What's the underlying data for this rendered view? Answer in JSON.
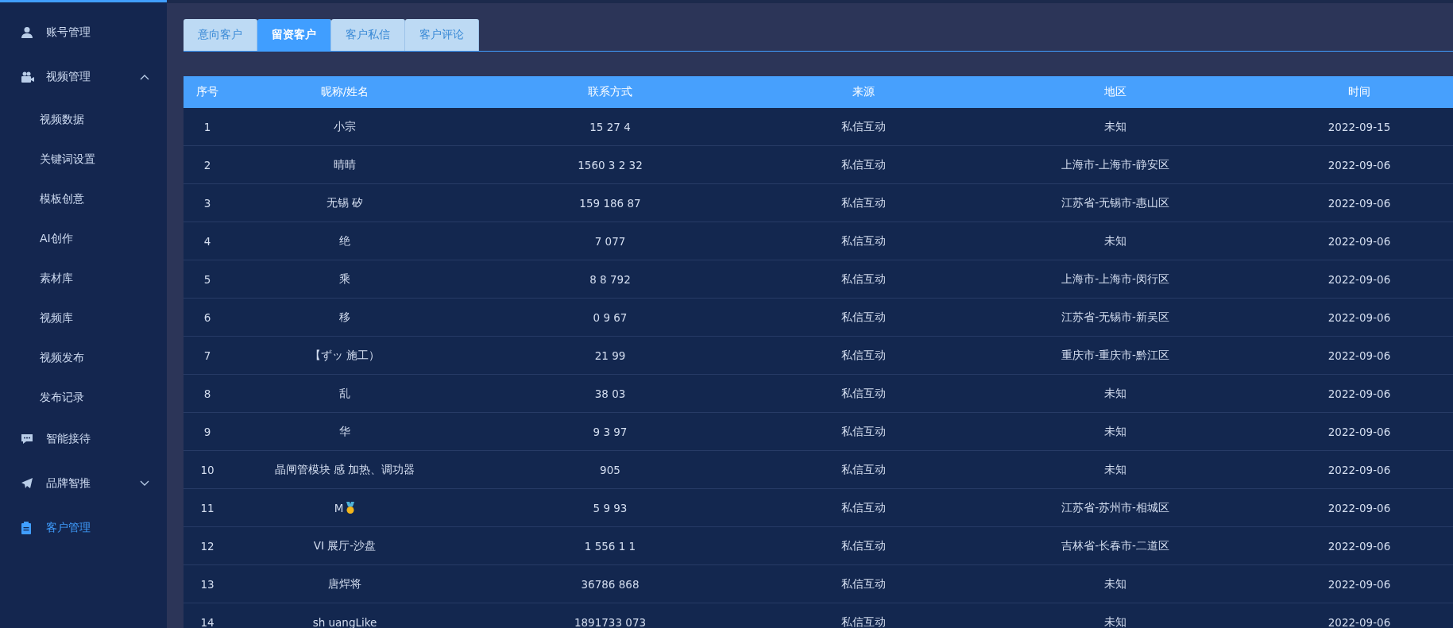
{
  "sidebar": {
    "items": [
      {
        "label": "账号管理",
        "selected": false
      },
      {
        "label": "视频管理",
        "selected": false,
        "expanded": true,
        "children": [
          {
            "label": "视频数据",
            "selected": false
          },
          {
            "label": "关键词设置",
            "selected": false
          },
          {
            "label": "模板创意",
            "selected": false
          },
          {
            "label": "AI创作",
            "selected": false
          },
          {
            "label": "素材库",
            "selected": false
          },
          {
            "label": "视频库",
            "selected": false
          },
          {
            "label": "视频发布",
            "selected": false
          },
          {
            "label": "发布记录",
            "selected": false
          }
        ]
      },
      {
        "label": "智能接待",
        "selected": false
      },
      {
        "label": "品牌智推",
        "selected": false,
        "expanded": false
      },
      {
        "label": "客户管理",
        "selected": true
      }
    ]
  },
  "tabs": [
    {
      "label": "意向客户",
      "selected": false
    },
    {
      "label": "留资客户",
      "selected": true
    },
    {
      "label": "客户私信",
      "selected": false
    },
    {
      "label": "客户评论",
      "selected": false
    }
  ],
  "table": {
    "columns": [
      "序号",
      "昵称/姓名",
      "联系方式",
      "来源",
      "地区",
      "时间"
    ],
    "rows": [
      {
        "index": "1",
        "name": "小宗",
        "contact": "15 27 4",
        "source": "私信互动",
        "region": "未知",
        "time": "2022-09-15"
      },
      {
        "index": "2",
        "name": "晴晴",
        "contact": "1560 3 2 32",
        "source": "私信互动",
        "region": "上海市-上海市-静安区",
        "time": "2022-09-06"
      },
      {
        "index": "3",
        "name": "无锡 矽",
        "contact": "159 186 87",
        "source": "私信互动",
        "region": "江苏省-无锡市-惠山区",
        "time": "2022-09-06"
      },
      {
        "index": "4",
        "name": "绝",
        "contact": "7 077",
        "source": "私信互动",
        "region": "未知",
        "time": "2022-09-06"
      },
      {
        "index": "5",
        "name": "乘",
        "contact": "8 8 792",
        "source": "私信互动",
        "region": "上海市-上海市-闵行区",
        "time": "2022-09-06"
      },
      {
        "index": "6",
        "name": "移",
        "contact": "0 9 67",
        "source": "私信互动",
        "region": "江苏省-无锡市-新吴区",
        "time": "2022-09-06"
      },
      {
        "index": "7",
        "name": "【ずッ 施工）",
        "contact": "21 99",
        "source": "私信互动",
        "region": "重庆市-重庆市-黔江区",
        "time": "2022-09-06"
      },
      {
        "index": "8",
        "name": "乱",
        "contact": "38 03",
        "source": "私信互动",
        "region": "未知",
        "time": "2022-09-06"
      },
      {
        "index": "9",
        "name": "华",
        "contact": "9 3 97",
        "source": "私信互动",
        "region": "未知",
        "time": "2022-09-06"
      },
      {
        "index": "10",
        "name": "晶闸管模块 感 加热、调功器",
        "contact": "905",
        "source": "私信互动",
        "region": "未知",
        "time": "2022-09-06"
      },
      {
        "index": "11",
        "name": "M",
        "medal": true,
        "contact": "5 9 93",
        "source": "私信互动",
        "region": "江苏省-苏州市-相城区",
        "time": "2022-09-06"
      },
      {
        "index": "12",
        "name": "VI 展厅-沙盘",
        "contact": "1 556 1 1",
        "source": "私信互动",
        "region": "吉林省-长春市-二道区",
        "time": "2022-09-06"
      },
      {
        "index": "13",
        "name": "唐焊将",
        "contact": "36786 868",
        "source": "私信互动",
        "region": "未知",
        "time": "2022-09-06"
      },
      {
        "index": "14",
        "name": "sh uangLike",
        "contact": "1891733 073",
        "source": "私信互动",
        "region": "未知",
        "time": "2022-09-06"
      }
    ]
  }
}
